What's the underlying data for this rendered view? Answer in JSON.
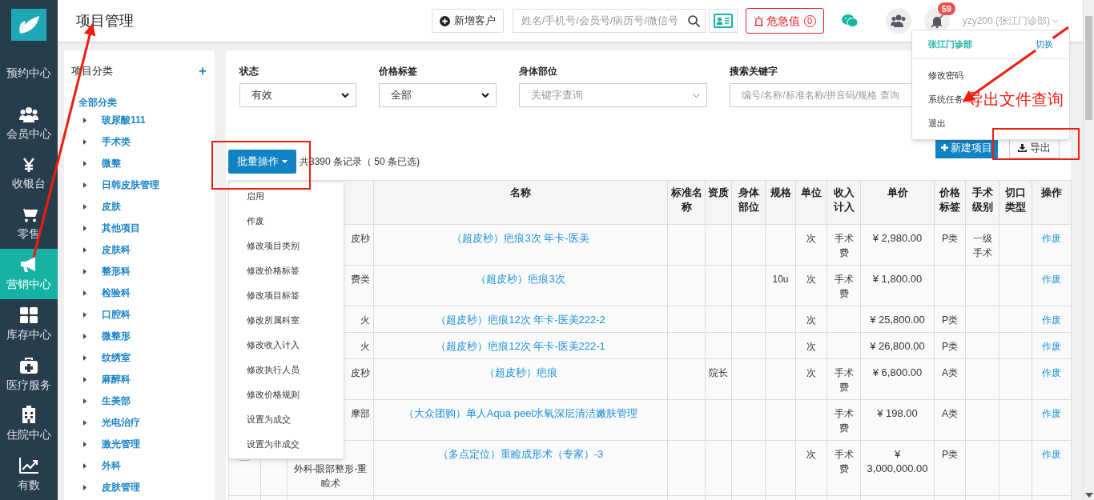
{
  "sidebar": {
    "items": [
      {
        "label": "预约中心",
        "selected": false
      },
      {
        "label": "会员中心",
        "selected": false
      },
      {
        "label": "收银台",
        "selected": false
      },
      {
        "label": "零售",
        "selected": false
      },
      {
        "label": "营销中心",
        "selected": true
      },
      {
        "label": "库存中心",
        "selected": false
      },
      {
        "label": "医疗服务",
        "selected": false
      },
      {
        "label": "住院中心",
        "selected": false
      },
      {
        "label": "有数",
        "selected": false
      }
    ]
  },
  "header": {
    "title": "项目管理",
    "new_customer": "新增客户",
    "search": {
      "placeholder": "姓名/手机号/会员号/病历号/微信号"
    },
    "critical": {
      "label": "危急值",
      "count": "0"
    },
    "notifications": "59",
    "user": "yzy200 (张江门诊部)"
  },
  "user_menu": {
    "clinic": "张江门诊部",
    "switch": "切换",
    "items": [
      "修改密码",
      "系统任务",
      "退出"
    ]
  },
  "categories": {
    "title": "项目分类",
    "add": "+",
    "root": "全部分类",
    "items": [
      "玻尿酸111",
      "手术类",
      "微整",
      "日韩皮肤管理",
      "皮肤",
      "其他项目",
      "皮肤科",
      "整形科",
      "检验科",
      "口腔科",
      "微整形",
      "纹绣室",
      "麻醉科",
      "生美部",
      "光电治疗",
      "激光管理",
      "外科",
      "皮肤管理"
    ]
  },
  "filters": [
    {
      "label": "状态",
      "kind": "select",
      "value": "有效"
    },
    {
      "label": "价格标签",
      "kind": "select",
      "value": "全部"
    },
    {
      "label": "身体部位",
      "kind": "combo",
      "placeholder": "关键字查询"
    },
    {
      "label": "搜索关键字",
      "kind": "input",
      "placeholder": "编号/名称/标准名称/拼音码/规格 查询"
    }
  ],
  "actions": {
    "new": "新建项目",
    "export": "导出",
    "batch": "批量操作",
    "summary": "共3390 条记录（ 50 条已选)"
  },
  "batch_menu": [
    "启用",
    "作废",
    "修改项目类别",
    "修改价格标签",
    "修改项目标签",
    "修改所属科室",
    "修改收入计入",
    "修改执行人员",
    "修改价格规则",
    "设置为成交",
    "设置为非成交"
  ],
  "table": {
    "columns": [
      "名称",
      "标准名称",
      "资质",
      "身体部位",
      "规格",
      "单位",
      "收入计入",
      "单价",
      "价格标签",
      "手术级别",
      "切口类型",
      "操作"
    ],
    "rows": [
      {
        "column_3": "皮秒",
        "cells": [
          "（超皮秒）疤痕3次 年卡-医美",
          "",
          "",
          "",
          "",
          "次",
          "手术费",
          "¥ 2,980.00",
          "P类",
          "一级手术",
          "",
          "作废"
        ]
      },
      {
        "column_3": "费类",
        "cells": [
          "（超皮秒）疤痕3次",
          "",
          "",
          "",
          "10u",
          "次",
          "手术费",
          "¥ 1,800.00",
          "",
          "",
          "",
          "作废"
        ]
      },
      {
        "column_3": "火",
        "cells": [
          "（超皮秒）疤痕12次 年卡-医美222-2",
          "",
          "",
          "",
          "",
          "次",
          "",
          "¥ 25,800.00",
          "P类",
          "",
          "",
          "作废"
        ]
      },
      {
        "column_3": "火",
        "cells": [
          "（超皮秒）疤痕12次 年卡-医美222-1",
          "",
          "",
          "",
          "",
          "次",
          "",
          "¥ 26,800.00",
          "P类",
          "",
          "",
          "作废"
        ]
      },
      {
        "column_3": "皮秒",
        "cells": [
          "（超皮秒）疤痕",
          "",
          "院长",
          "",
          "",
          "次",
          "手术费",
          "¥ 6,800.00",
          "A类",
          "",
          "",
          "作废"
        ]
      },
      {
        "column_3": "摩部",
        "cells": [
          "（大众团购）单人Aqua peel水氧深层清洁嫩肤管理",
          "",
          "",
          "",
          "",
          "",
          "手术费",
          "¥ 198.00",
          "A类",
          "",
          "",
          "作废"
        ]
      },
      {
        "column_3": "外科-眼部整形-重睑术",
        "checked": false,
        "cells": [
          "（多点定位）重睑成形术（专家）-3",
          "",
          "",
          "",
          "",
          "次",
          "手术费",
          "¥ 3,000,000.00",
          "P类",
          "",
          "",
          "作废"
        ]
      }
    ]
  },
  "annotation": "导出文件查询"
}
